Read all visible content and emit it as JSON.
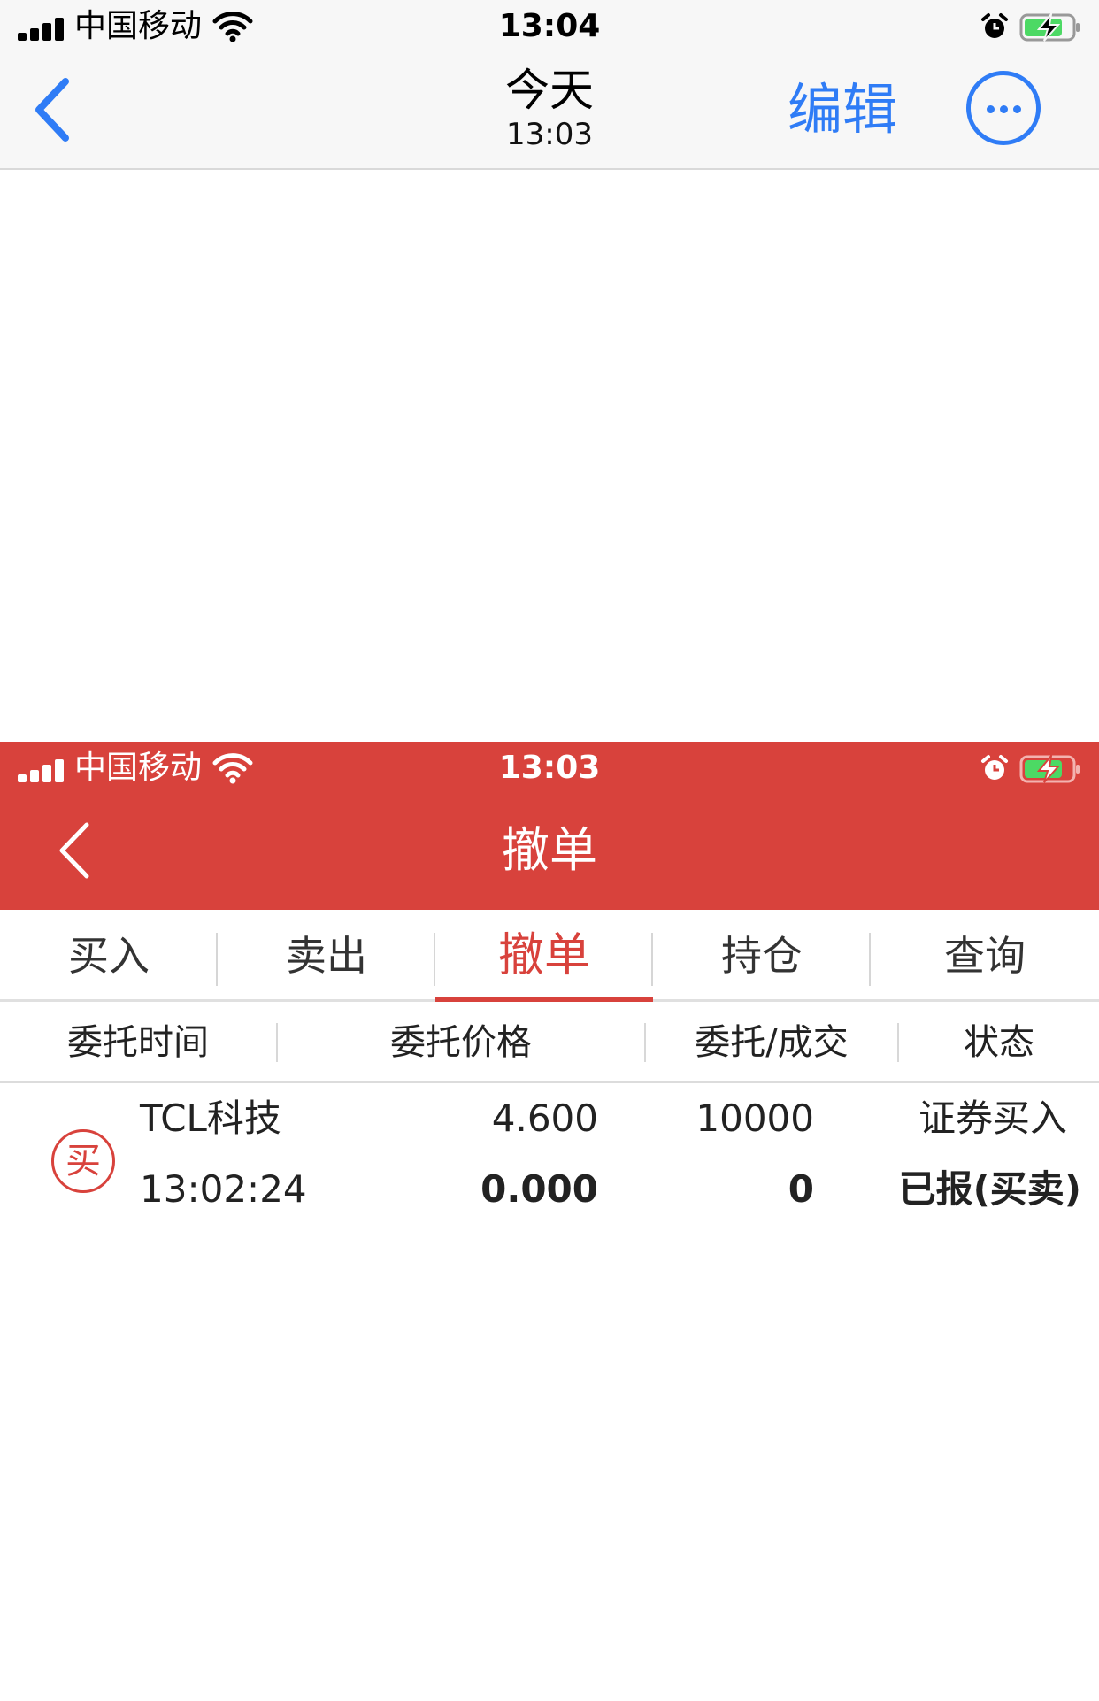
{
  "outer_status_bar": {
    "carrier": "中国移动",
    "time": "13:04",
    "signal_icon": "cellular-signal-icon",
    "wifi_icon": "wifi-icon",
    "alarm_icon": "alarm-clock-icon",
    "battery_icon": "battery-charging-icon"
  },
  "outer_nav": {
    "title": "今天",
    "subtitle": "13:03",
    "edit_label": "编辑",
    "accent_color": "#2f7cf6"
  },
  "inner_status_bar": {
    "carrier": "中国移动",
    "time": "13:03"
  },
  "inner_nav": {
    "title": "撤单",
    "brand_color": "#d8423c"
  },
  "tabs": [
    {
      "label": "买入"
    },
    {
      "label": "卖出"
    },
    {
      "label": "撤单",
      "active": true
    },
    {
      "label": "持仓"
    },
    {
      "label": "查询"
    }
  ],
  "columns": [
    "委托时间",
    "委托价格",
    "委托/成交",
    "状态"
  ],
  "orders": [
    {
      "badge": "买",
      "name": "TCL科技",
      "time": "13:02:24",
      "order_price": "4.600",
      "deal_price": "0.000",
      "order_qty": "10000",
      "deal_qty": "0",
      "type": "证券买入",
      "status": "已报(买卖)"
    }
  ]
}
